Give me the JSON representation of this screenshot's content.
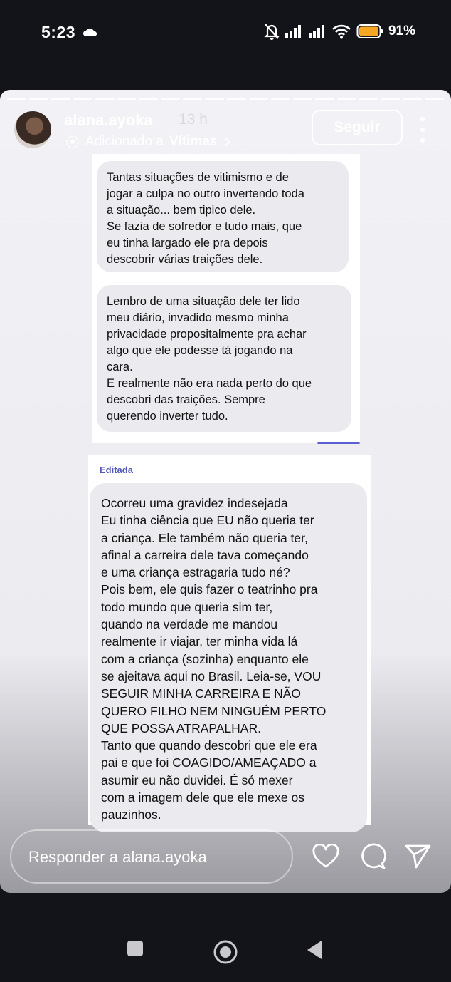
{
  "status_bar": {
    "time": "5:23",
    "battery_percent": "91%",
    "icons": [
      "cloud-icon",
      "mute-bell-icon",
      "signal-icon",
      "signal-icon",
      "wifi-icon",
      "battery-icon"
    ]
  },
  "story": {
    "segments": 20,
    "username": "alana.ayoka",
    "time_ago": "13 h",
    "added_prefix": "Adicionado a",
    "highlight_name": "Vítimas",
    "follow_label": "Seguir"
  },
  "chat1": {
    "bubble1": "Tantas situações de vitimismo e de\njogar a culpa no outro invertendo toda\na situação... bem tipico dele.\nSe fazia de sofredor e tudo mais, que\neu tinha largado ele pra depois\ndescobrir várias traições dele.",
    "bubble2": "Lembro de uma situação dele ter lido\nmeu diário, invadido mesmo minha\nprivacidade propositalmente pra achar\nalgo que ele podesse tá jogando na\ncara.\nE realmente não era nada perto do que\ndescobri das traições. Sempre\nquerendo inverter tudo."
  },
  "chat2": {
    "edited_label": "Editada",
    "bubble3": "Ocorreu uma gravidez indesejada\nEu tinha ciência que EU não queria ter\na criança. Ele também não queria ter,\nafinal a carreira dele tava começando\ne uma criança estragaria tudo né?\nPois bem, ele quis fazer o teatrinho pra\ntodo mundo que queria sim ter,\nquando na verdade me mandou\nrealmente ir viajar, ter minha vida lá\ncom a criança (sozinha) enquanto ele\nse ajeitava aqui no Brasil. Leia-se, VOU\nSEGUIR MINHA CARREIRA E NÃO\nQUERO FILHO NEM NINGUÉM PERTO\nQUE POSSA ATRAPALHAR.\nTanto que quando descobri que ele era\npai e que foi COAGIDO/AMEAÇADO a\nasumir eu não duvidei.  É só mexer\ncom a imagem dele que ele mexe os\npauzinhos."
  },
  "reply": {
    "placeholder": "Responder a alana.ayoka"
  },
  "colors": {
    "accent_purple": "#5c5fd1",
    "bubble_gray": "#ebebef",
    "dark_bg": "#121419"
  }
}
